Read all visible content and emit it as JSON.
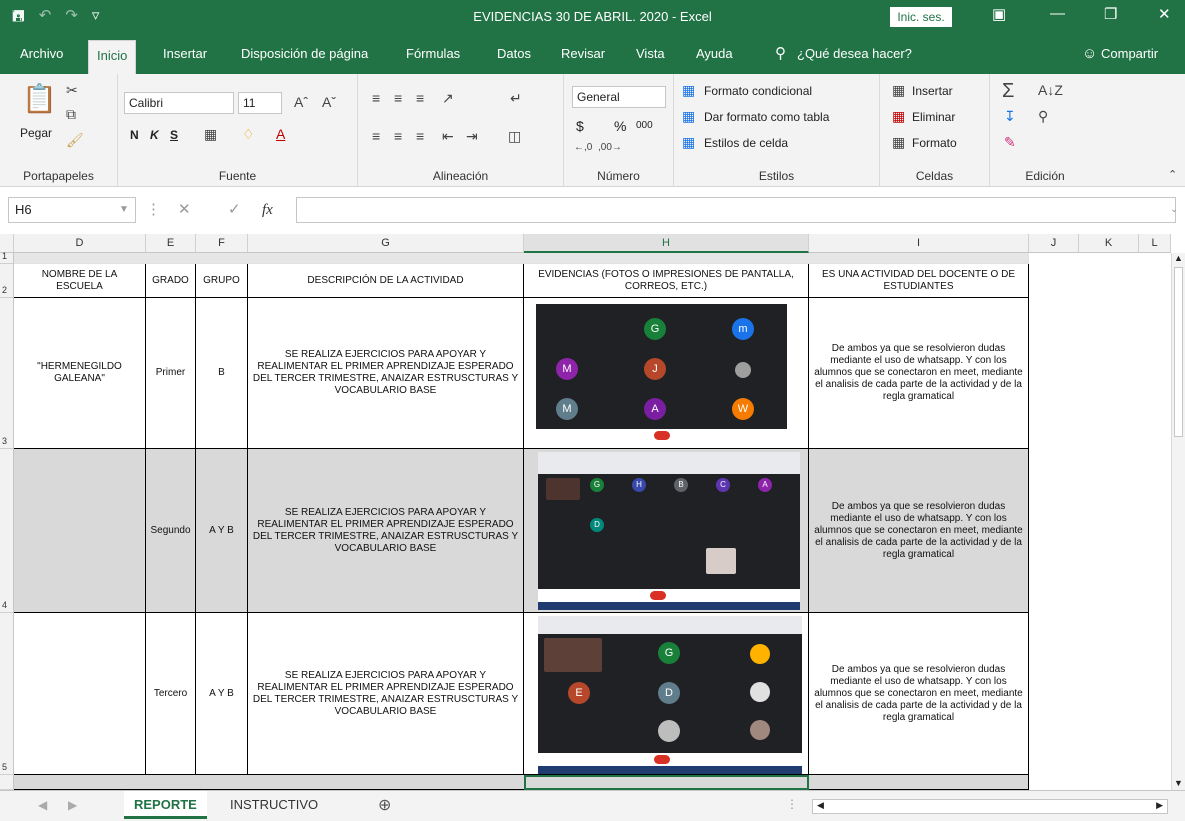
{
  "window": {
    "title": "EVIDENCIAS 30 DE ABRIL. 2020  -  Excel",
    "signin_label": "Inic. ses.",
    "save_icon": "save-icon",
    "undo_icon": "undo-icon",
    "redo_icon": "redo-icon"
  },
  "tabs": [
    "Archivo",
    "Inicio",
    "Insertar",
    "Disposición de página",
    "Fórmulas",
    "Datos",
    "Revisar",
    "Vista",
    "Ayuda"
  ],
  "active_tab": "Inicio",
  "tell_me": "¿Qué desea hacer?",
  "share_label": "Compartir",
  "ribbon": {
    "clipboard": {
      "paste_label": "Pegar",
      "group_label": "Portapapeles"
    },
    "font": {
      "name": "Calibri",
      "size": "11",
      "bold": "N",
      "italic": "K",
      "underline": "S",
      "group_label": "Fuente"
    },
    "alignment": {
      "group_label": "Alineación"
    },
    "number": {
      "format": "General",
      "currency": "$",
      "percent": "%",
      "thousands": "000",
      "group_label": "Número"
    },
    "styles": {
      "conditional": "Formato condicional",
      "as_table": "Dar formato como tabla",
      "cell_styles": "Estilos de celda",
      "group_label": "Estilos"
    },
    "cells": {
      "insert": "Insertar",
      "delete": "Eliminar",
      "format": "Formato",
      "group_label": "Celdas"
    },
    "editing": {
      "group_label": "Edición"
    }
  },
  "formula_bar": {
    "name_box": "H6",
    "fx": "fx",
    "value": ""
  },
  "columns": [
    "D",
    "E",
    "F",
    "G",
    "H",
    "I",
    "J",
    "K",
    "L"
  ],
  "selected_column": "H",
  "rows": [
    "1",
    "2",
    "3",
    "4",
    "5"
  ],
  "header_row": {
    "escuela": "NOMBRE DE LA ESCUELA",
    "grado": "GRADO",
    "grupo": "GRUPO",
    "descripcion": "DESCRIPCIÓN DE LA ACTIVIDAD",
    "evidencias": "EVIDENCIAS (FOTOS O IMPRESIONES DE PANTALLA, CORREOS, ETC.)",
    "actividad": "ES UNA ACTIVIDAD DEL DOCENTE O DE ESTUDIANTES"
  },
  "data_rows": [
    {
      "escuela": "\"HERMENEGILDO GALEANA\"",
      "grado": "Primer",
      "grupo": "B",
      "descripcion": "SE REALIZA EJERCICIOS PARA APOYAR Y REALIMENTAR EL PRIMER  APRENDIZAJE ESPERADO DEL TERCER TRIMESTRE, ANAIZAR ESTRUSCTURAS Y VOCABULARIO BASE",
      "actividad": "De ambos ya que se resolvieron dudas mediante el uso de whatsapp. Y con los alumnos que se conectaron en meet, mediante el analisis de cada parte de la actividad y de la regla gramatical"
    },
    {
      "escuela": "",
      "grado": "Segundo",
      "grupo": "A Y B",
      "descripcion": "SE REALIZA EJERCICIOS PARA APOYAR Y REALIMENTAR EL PRIMER  APRENDIZAJE ESPERADO DEL TERCER TRIMESTRE, ANAIZAR ESTRUSCTURAS Y VOCABULARIO BASE",
      "actividad": "De ambos ya que se resolvieron dudas mediante el uso de whatsapp. Y con los alumnos que se conectaron en meet, mediante el analisis de cada parte de la actividad y de la regla gramatical"
    },
    {
      "escuela": "",
      "grado": "Tercero",
      "grupo": "A Y B",
      "descripcion": "SE REALIZA EJERCICIOS PARA APOYAR Y REALIMENTAR EL PRIMER  APRENDIZAJE ESPERADO DEL TERCER TRIMESTRE, ANAIZAR ESTRUSCTURAS Y VOCABULARIO BASE",
      "actividad": "De ambos ya que se resolvieron dudas mediante el uso de whatsapp. Y con los alumnos que se conectaron en meet, mediante el analisis de cada parte de la actividad y de la regla gramatical"
    }
  ],
  "meet_screenshots": [
    {
      "avatars": [
        "G",
        "m",
        "M",
        "J",
        "M",
        "A",
        "W"
      ],
      "colors": [
        "#188038",
        "#1a73e8",
        "#8e24aa",
        "#b7472a",
        "#607d8b",
        "#7b1fa2",
        "#f57c00"
      ]
    },
    {
      "avatars": [
        "G",
        "H",
        "B",
        "C",
        "A",
        "D"
      ],
      "colors": [
        "#188038",
        "#3949ab",
        "#5f6368",
        "#5e35b1",
        "#8e24aa",
        "#00897b"
      ]
    },
    {
      "avatars": [
        "G",
        "E",
        "D"
      ],
      "colors": [
        "#188038",
        "#b7472a",
        "#607d8b"
      ]
    }
  ],
  "sheets": [
    "REPORTE",
    "INSTRUCTIVO"
  ],
  "active_sheet": "REPORTE",
  "add_sheet_icon": "plus-circle-icon"
}
